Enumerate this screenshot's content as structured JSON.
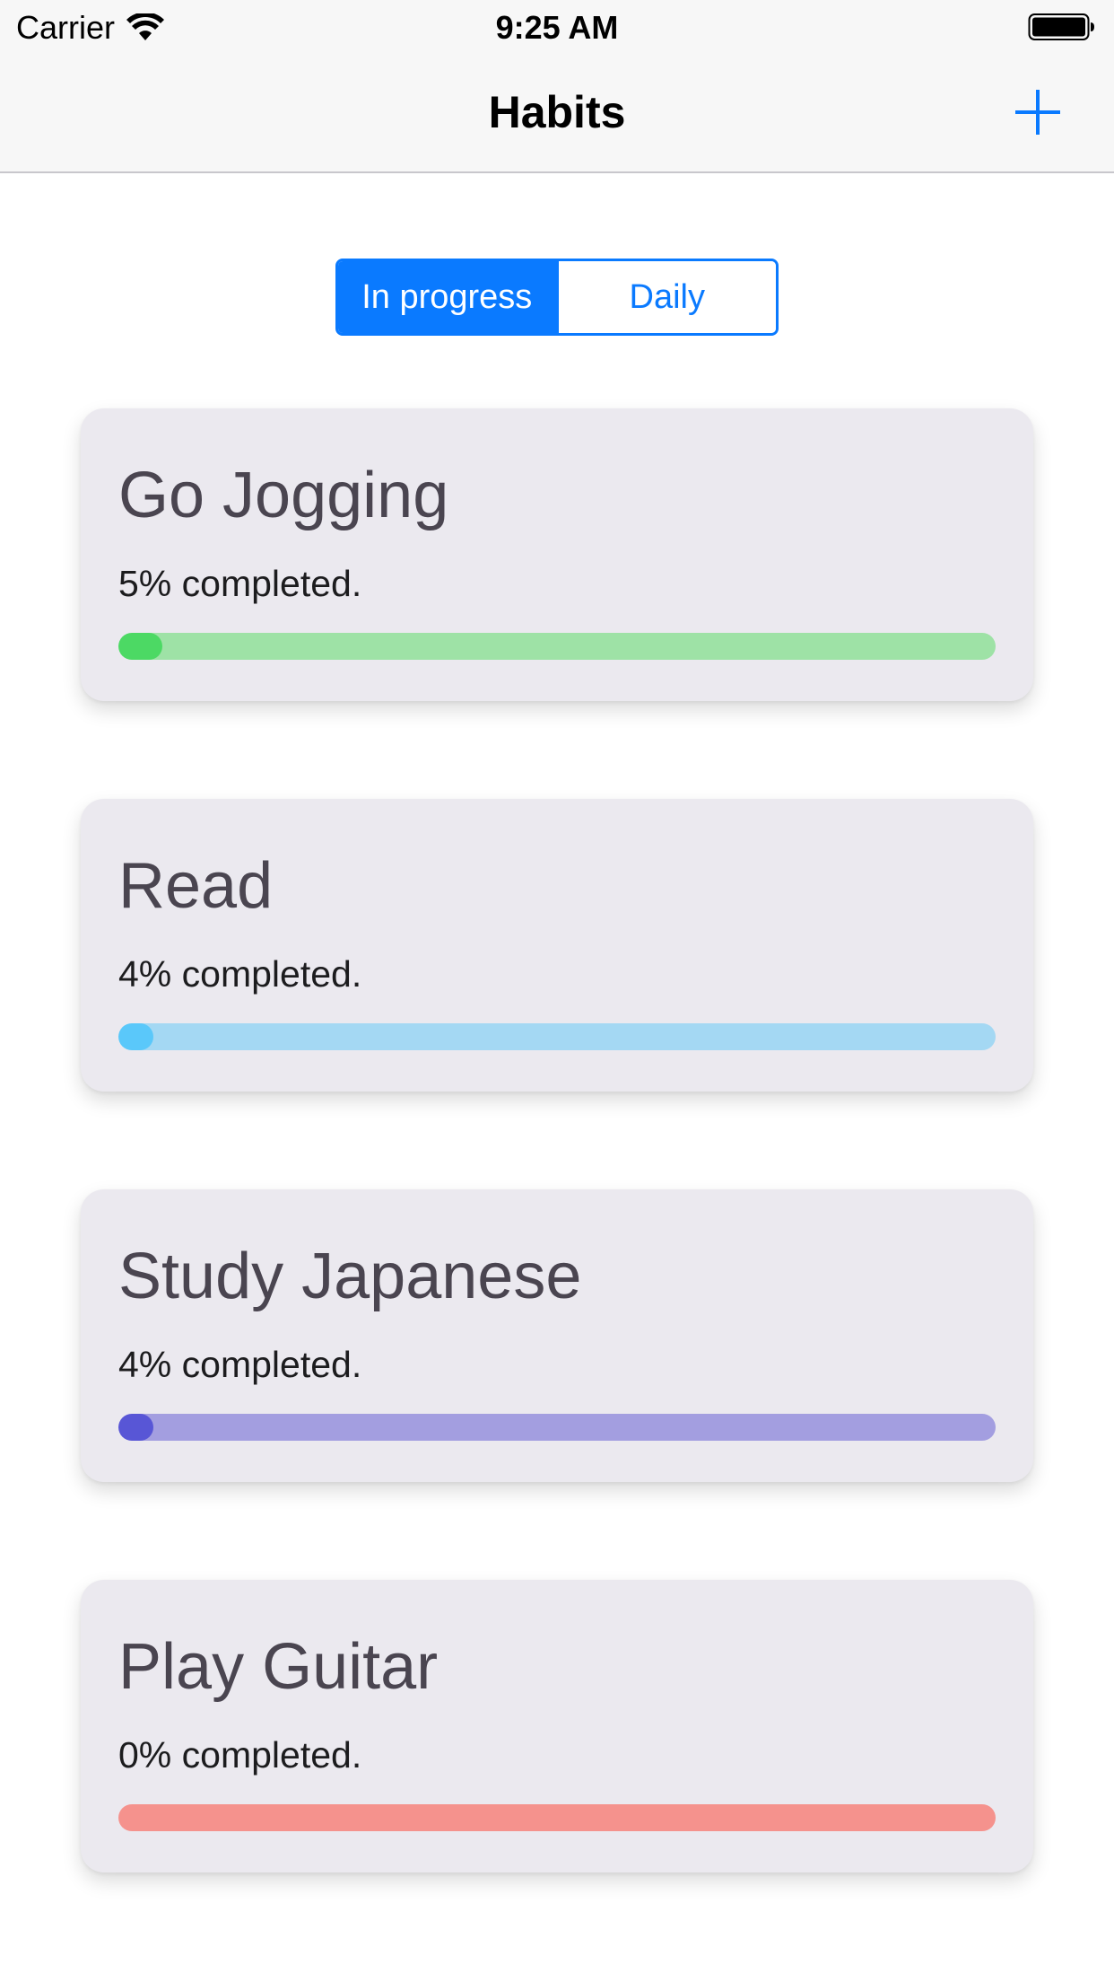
{
  "status_bar": {
    "carrier": "Carrier",
    "time": "9:25 AM"
  },
  "nav": {
    "title": "Habits",
    "add_icon": "plus-icon"
  },
  "segmented": {
    "items": [
      {
        "label": "In progress",
        "selected": true
      },
      {
        "label": "Daily",
        "selected": false
      }
    ]
  },
  "habits": [
    {
      "title": "Go Jogging",
      "progress_text": "5% completed.",
      "progress": 0.05,
      "track_color": "#9ee2a6",
      "fill_color": "#4cd964"
    },
    {
      "title": "Read",
      "progress_text": "4% completed.",
      "progress": 0.04,
      "track_color": "#a4d8f3",
      "fill_color": "#5ac8fa"
    },
    {
      "title": "Study Japanese",
      "progress_text": "4% completed.",
      "progress": 0.04,
      "track_color": "#a39ee0",
      "fill_color": "#5856d6"
    },
    {
      "title": "Play Guitar",
      "progress_text": "0% completed.",
      "progress": 0.0,
      "track_color": "#f5928d",
      "fill_color": "#ff3b30"
    }
  ]
}
